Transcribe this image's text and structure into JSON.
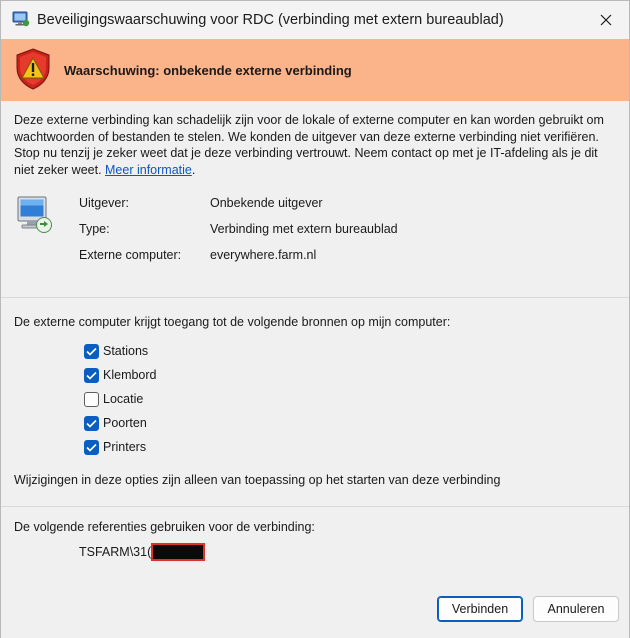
{
  "window": {
    "title": "Beveiligingswaarschuwing voor RDC (verbinding met extern bureaublad)",
    "close_icon": "close-icon"
  },
  "banner": {
    "heading": "Waarschuwing: onbekende externe verbinding",
    "icon": "warning-shield-icon",
    "color": "#fbb38a"
  },
  "description": {
    "text": "Deze externe verbinding kan schadelijk zijn voor de lokale of externe computer en kan worden gebruikt om wachtwoorden of bestanden te stelen. We konden de uitgever van deze externe verbinding niet verifiëren. Stop nu tenzij je zeker weet dat je deze verbinding vertrouwt. Neem contact op met je IT-afdeling als je dit niet zeker weet. ",
    "link": "Meer informatie",
    "after_link": "."
  },
  "details": [
    {
      "label": "Uitgever:",
      "value": "Onbekende uitgever"
    },
    {
      "label": "Type:",
      "value": "Verbinding met extern bureaublad"
    },
    {
      "label": "Externe computer:",
      "value": "everywhere.farm.nl"
    }
  ],
  "resources": {
    "intro": "De externe computer krijgt toegang tot de volgende bronnen op mijn computer:",
    "items": [
      {
        "label": "Stations",
        "checked": true
      },
      {
        "label": "Klembord",
        "checked": true
      },
      {
        "label": "Locatie",
        "checked": false
      },
      {
        "label": "Poorten",
        "checked": true
      },
      {
        "label": "Printers",
        "checked": true
      }
    ],
    "note": "Wijzigingen in deze opties zijn alleen van toepassing op het starten van deze verbinding"
  },
  "credentials": {
    "intro": "De volgende referenties gebruiken voor de verbinding:",
    "username_visible": "TSFARM\\31("
  },
  "buttons": {
    "connect": "Verbinden",
    "cancel": "Annuleren"
  },
  "colors": {
    "accent": "#0a5ec2",
    "link": "#0a57c2",
    "redaction_border": "#e0302a"
  }
}
